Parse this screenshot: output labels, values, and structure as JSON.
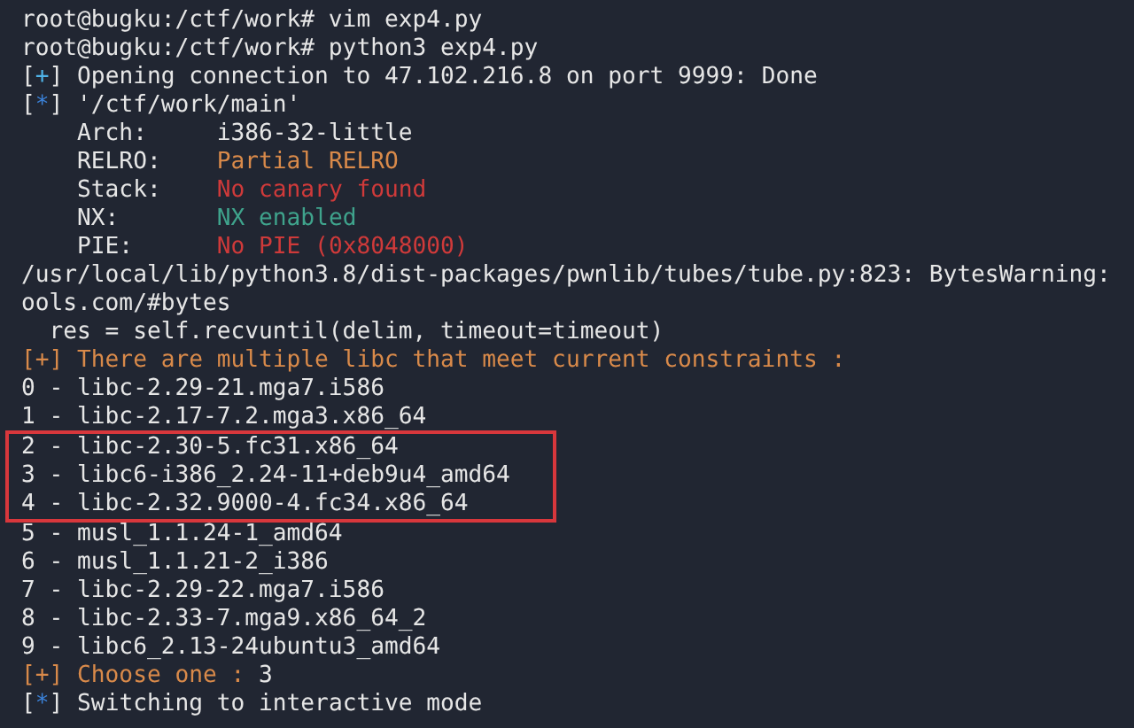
{
  "terminal": {
    "blocks": [
      {
        "kind": "plain",
        "lines": [
          {
            "segments": [
              {
                "text": "root@bugku:/ctf/work# vim exp4.py",
                "color": "#e6e6e6"
              }
            ]
          },
          {
            "segments": [
              {
                "text": "root@bugku:/ctf/work# python3 exp4.py",
                "color": "#e6e6e6"
              }
            ]
          },
          {
            "segments": [
              {
                "text": "[",
                "color": "#e6e6e6"
              },
              {
                "text": "+",
                "color": "#4fb3e8"
              },
              {
                "text": "] Opening connection to 47.102.216.8 on port 9999: Done",
                "color": "#e6e6e6"
              }
            ]
          },
          {
            "segments": [
              {
                "text": "[",
                "color": "#e6e6e6"
              },
              {
                "text": "*",
                "color": "#3b82d9"
              },
              {
                "text": "] '/ctf/work/main'",
                "color": "#e6e6e6"
              }
            ]
          },
          {
            "segments": [
              {
                "text": "    Arch:     i386-32-little",
                "color": "#e6e6e6"
              }
            ]
          },
          {
            "segments": [
              {
                "text": "    RELRO:    ",
                "color": "#e6e6e6"
              },
              {
                "text": "Partial RELRO",
                "color": "#d98a4a"
              }
            ]
          },
          {
            "segments": [
              {
                "text": "    Stack:    ",
                "color": "#e6e6e6"
              },
              {
                "text": "No canary found",
                "color": "#cf3a3a"
              }
            ]
          },
          {
            "segments": [
              {
                "text": "    NX:       ",
                "color": "#e6e6e6"
              },
              {
                "text": "NX enabled",
                "color": "#3fa38c"
              }
            ]
          },
          {
            "segments": [
              {
                "text": "    PIE:      ",
                "color": "#e6e6e6"
              },
              {
                "text": "No PIE (0x8048000)",
                "color": "#cf3a3a"
              }
            ]
          },
          {
            "segments": [
              {
                "text": "/usr/local/lib/python3.8/dist-packages/pwnlib/tubes/tube.py:823: BytesWarning:",
                "color": "#e6e6e6"
              }
            ]
          },
          {
            "segments": [
              {
                "text": "ools.com/#bytes",
                "color": "#e6e6e6"
              }
            ]
          },
          {
            "segments": [
              {
                "text": "  res = self.recvuntil(delim, timeout=timeout)",
                "color": "#e6e6e6"
              }
            ]
          },
          {
            "segments": [
              {
                "text": "[+] There are multiple libc that meet current constraints :",
                "color": "#d98a4a"
              }
            ]
          },
          {
            "segments": [
              {
                "text": "0 - libc-2.29-21.mga7.i586",
                "color": "#e6e6e6"
              }
            ]
          },
          {
            "segments": [
              {
                "text": "1 - libc-2.17-7.2.mga3.x86_64",
                "color": "#e6e6e6"
              }
            ]
          }
        ]
      },
      {
        "kind": "highlighted",
        "lines": [
          {
            "segments": [
              {
                "text": "2 - libc-2.30-5.fc31.x86_64",
                "color": "#e6e6e6"
              }
            ]
          },
          {
            "segments": [
              {
                "text": "3 - libc6-i386_2.24-11+deb9u4_amd64",
                "color": "#e6e6e6"
              }
            ]
          },
          {
            "segments": [
              {
                "text": "4 - libc-2.32.9000-4.fc34.x86_64",
                "color": "#e6e6e6"
              }
            ]
          }
        ]
      },
      {
        "kind": "plain",
        "lines": [
          {
            "segments": [
              {
                "text": "5 - musl_1.1.24-1_amd64",
                "color": "#e6e6e6"
              }
            ]
          },
          {
            "segments": [
              {
                "text": "6 - musl_1.1.21-2_i386",
                "color": "#e6e6e6"
              }
            ]
          },
          {
            "segments": [
              {
                "text": "7 - libc-2.29-22.mga7.i586",
                "color": "#e6e6e6"
              }
            ]
          },
          {
            "segments": [
              {
                "text": "8 - libc-2.33-7.mga9.x86_64_2",
                "color": "#e6e6e6"
              }
            ]
          },
          {
            "segments": [
              {
                "text": "9 - libc6_2.13-24ubuntu3_amd64",
                "color": "#e6e6e6"
              }
            ]
          },
          {
            "segments": [
              {
                "text": "[+] Choose one : ",
                "color": "#d98a4a"
              },
              {
                "text": "3",
                "color": "#e6e6e6"
              }
            ]
          },
          {
            "segments": [
              {
                "text": "[",
                "color": "#e6e6e6"
              },
              {
                "text": "*",
                "color": "#3b82d9"
              },
              {
                "text": "] Switching to interactive mode",
                "color": "#e6e6e6"
              }
            ]
          }
        ]
      }
    ]
  }
}
